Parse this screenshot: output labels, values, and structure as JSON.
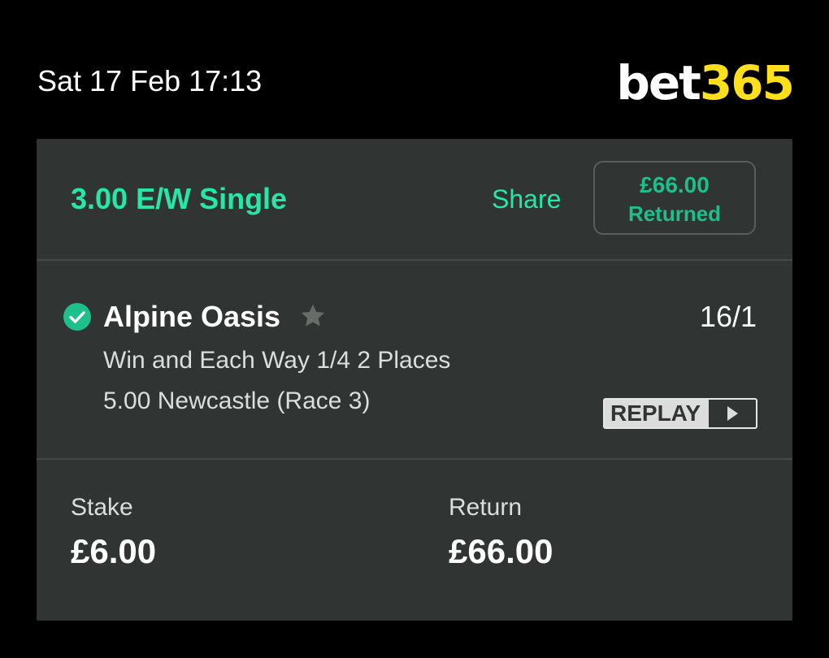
{
  "status_bar": {
    "datetime": "Sat 17 Feb 17:13"
  },
  "brand": {
    "logo_bet": "bet",
    "logo_num": "365",
    "colors": {
      "bet": "#ffffff",
      "num": "#ffdf1b"
    }
  },
  "bet": {
    "title": "3.00 E/W Single",
    "share_label": "Share",
    "returned_amount": "£66.00",
    "returned_label": "Returned",
    "accent_color": "#27e6a6"
  },
  "selection": {
    "status_icon": "check-circle-icon",
    "name": "Alpine Oasis",
    "favourite_icon": "star-icon",
    "odds": "16/1",
    "market": "Win and Each Way 1/4 2 Places",
    "event": "5.00 Newcastle (Race 3)",
    "replay_label": "REPLAY",
    "replay_icon": "play-icon"
  },
  "totals": {
    "stake_label": "Stake",
    "stake_value": "£6.00",
    "return_label": "Return",
    "return_value": "£66.00"
  }
}
